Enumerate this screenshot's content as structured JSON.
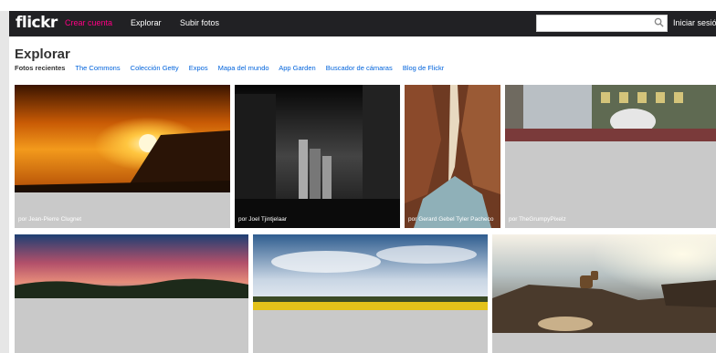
{
  "topbar": {
    "logo": "flickr",
    "create_account": "Crear cuenta",
    "explore": "Explorar",
    "upload": "Subir fotos",
    "search_placeholder": "",
    "login": "Iniciar sesión"
  },
  "page": {
    "title": "Explorar",
    "tabs": [
      "Fotos recientes",
      "The Commons",
      "Colección Getty",
      "Expos",
      "Mapa del mundo",
      "App Garden",
      "Buscador de cámaras",
      "Blog de Flickr"
    ]
  },
  "photos": [
    {
      "credit": "por Jean-Pierre Clugnet"
    },
    {
      "credit": "por Joel Tjintjelaar"
    },
    {
      "credit": "por Gerard Gebel Tyler Pacheco"
    },
    {
      "credit": "por TheGrumpyPixelz"
    },
    {
      "credit": ""
    },
    {
      "credit": ""
    },
    {
      "credit": ""
    }
  ],
  "colors": {
    "brand_pink": "#ff0084",
    "topbar_bg": "#212124",
    "link_blue": "#0063dc"
  },
  "icons": {
    "search": "search-icon"
  }
}
